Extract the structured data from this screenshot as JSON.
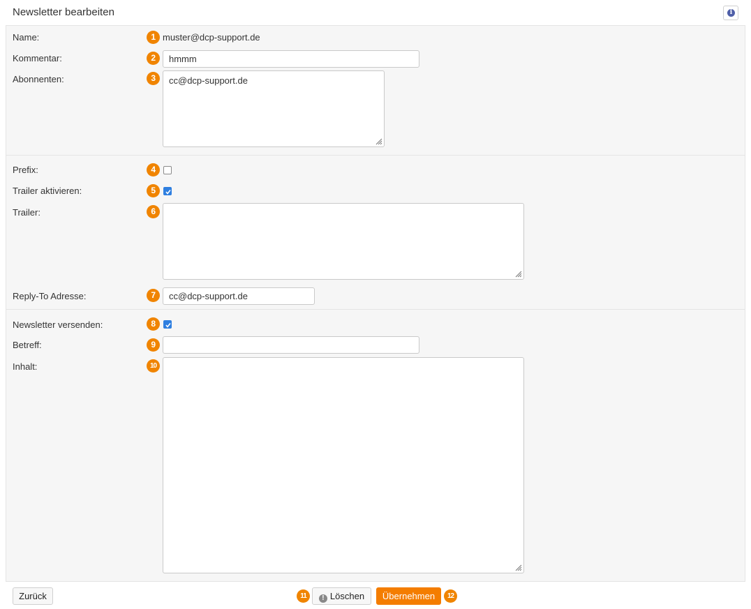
{
  "header": {
    "title": "Newsletter bearbeiten",
    "info_icon": "info-icon",
    "info_glyph": "i"
  },
  "form": {
    "name": {
      "label": "Name:",
      "value": "muster@dcp-support.de",
      "badge": "1"
    },
    "kommentar": {
      "label": "Kommentar:",
      "value": "hmmm",
      "badge": "2"
    },
    "abonnenten": {
      "label": "Abonnenten:",
      "value": "cc@dcp-support.de",
      "badge": "3"
    },
    "prefix": {
      "label": "Prefix:",
      "checked": false,
      "badge": "4"
    },
    "trailer_aktivieren": {
      "label": "Trailer aktivieren:",
      "checked": true,
      "badge": "5"
    },
    "trailer": {
      "label": "Trailer:",
      "value": "",
      "badge": "6"
    },
    "reply_to": {
      "label": "Reply-To Adresse:",
      "value": "cc@dcp-support.de",
      "badge": "7"
    },
    "newsletter_versenden": {
      "label": "Newsletter versenden:",
      "checked": true,
      "badge": "8"
    },
    "betreff": {
      "label": "Betreff:",
      "value": "",
      "badge": "9"
    },
    "inhalt": {
      "label": "Inhalt:",
      "value": "",
      "badge": "10"
    }
  },
  "footer": {
    "back_label": "Zurück",
    "delete_label": "Löschen",
    "delete_badge": "11",
    "delete_icon_glyph": "!",
    "apply_label": "Übernehmen",
    "apply_badge": "12"
  },
  "colors": {
    "accent": "#f47d00",
    "badge": "#f08400",
    "checkbox": "#2f7fe0",
    "panel": "#f6f6f6"
  }
}
